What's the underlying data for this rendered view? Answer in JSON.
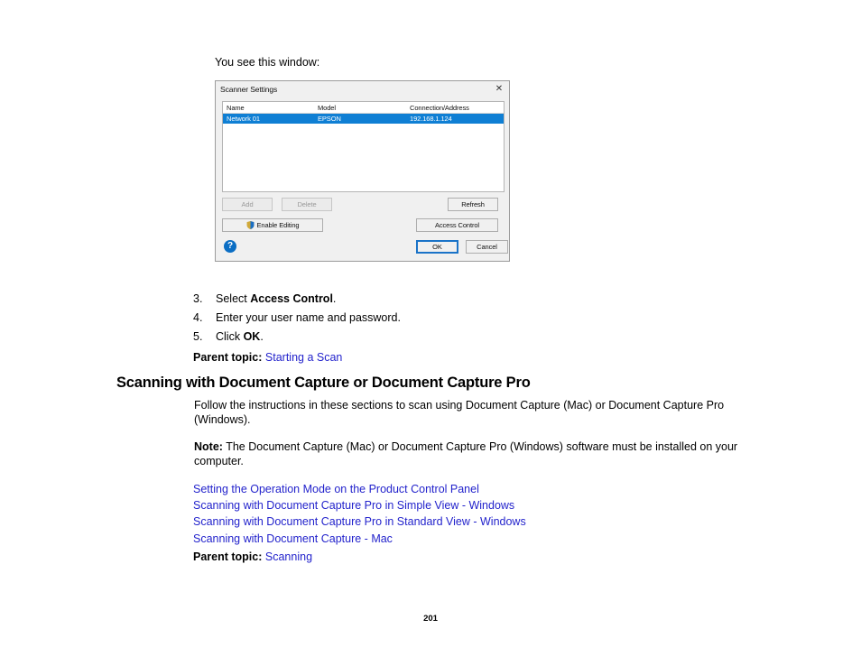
{
  "document": {
    "intro_line": "You see this window:",
    "page_number": "201"
  },
  "dialog": {
    "title": "Scanner Settings",
    "close_icon": "close-icon",
    "list": {
      "columns": [
        "Name",
        "Model",
        "Connection/Address"
      ],
      "rows": [
        {
          "name": "Network 01",
          "model": "EPSON",
          "connection": "192.168.1.124",
          "selected": true
        }
      ],
      "selection_color": "#0f7fd4"
    },
    "buttons": {
      "add": "Add",
      "delete": "Delete",
      "refresh": "Refresh",
      "enable_editing": "Enable Editing",
      "access_control": "Access Control",
      "ok": "OK",
      "cancel": "Cancel"
    },
    "help_icon_label": "?",
    "focus_color": "#1a73c8"
  },
  "steps": [
    {
      "num": "3.",
      "pre": "Select ",
      "bold": "Access Control",
      "post": "."
    },
    {
      "num": "4.",
      "pre": "Enter your user name and password.",
      "bold": "",
      "post": ""
    },
    {
      "num": "5.",
      "pre": "Click ",
      "bold": "OK",
      "post": "."
    }
  ],
  "parent_topic_1": {
    "label": "Parent topic:",
    "link": "Starting a Scan"
  },
  "section": {
    "heading": "Scanning with Document Capture or Document Capture Pro",
    "intro": "Follow the instructions in these sections to scan using Document Capture (Mac) or Document Capture Pro (Windows).",
    "note_label": "Note:",
    "note_text": " The Document Capture (Mac) or Document Capture Pro (Windows) software must be installed on your computer.",
    "links": [
      "Setting the Operation Mode on the Product Control Panel",
      "Scanning with Document Capture Pro in Simple View - Windows",
      "Scanning with Document Capture Pro in Standard View - Windows",
      "Scanning with Document Capture - Mac"
    ]
  },
  "parent_topic_2": {
    "label": "Parent topic:",
    "link": "Scanning"
  },
  "colors": {
    "link": "#2323cc",
    "selection": "#0f7fd4",
    "help": "#0b6ec4"
  }
}
